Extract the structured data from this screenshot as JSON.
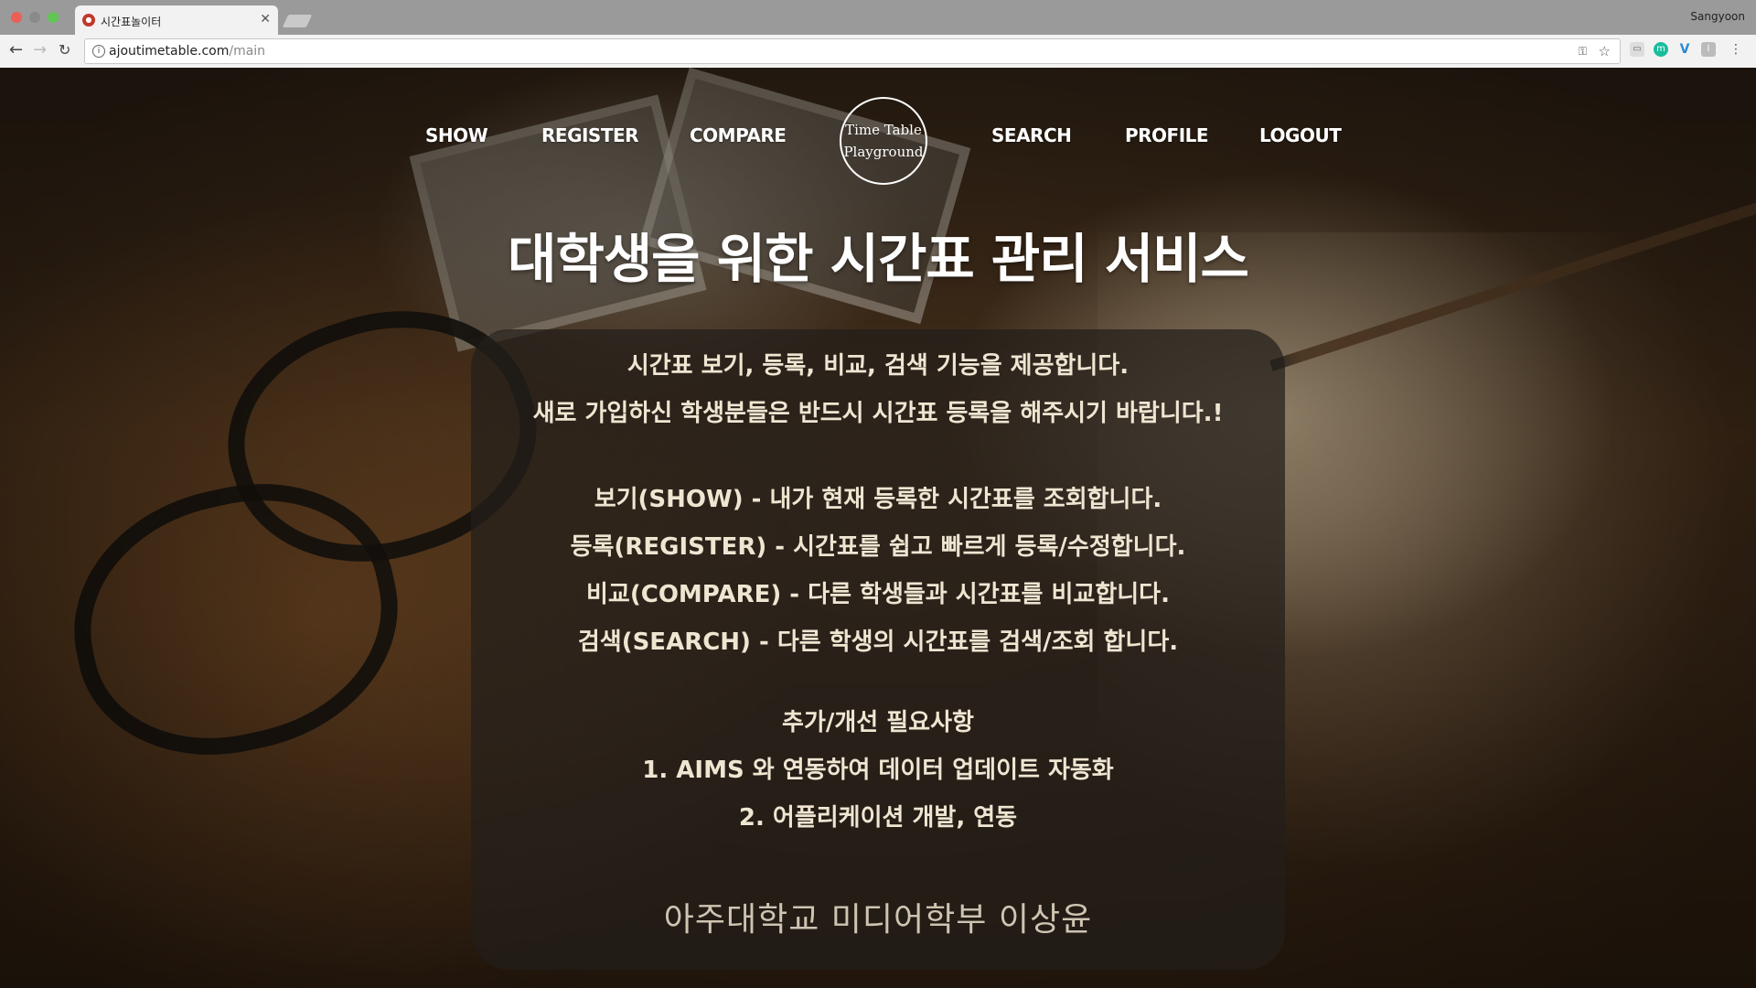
{
  "browser": {
    "tab_title": "시간표놀이터",
    "user_name": "Sangyoon",
    "url_host": "ajoutimetable.com",
    "url_path": "/main"
  },
  "nav": {
    "show": "SHOW",
    "register": "REGISTER",
    "compare": "COMPARE",
    "search": "SEARCH",
    "profile": "PROFILE",
    "logout": "LOGOUT",
    "logo_line1": "Time Table",
    "logo_line2": "Playground"
  },
  "headline": "대학생을 위한 시간표 관리 서비스",
  "panel": {
    "intro": [
      "시간표 보기, 등록, 비교, 검색 기능을 제공합니다.",
      "새로 가입하신 학생분들은 반드시 시간표 등록을 해주시기 바랍니다.!"
    ],
    "features": [
      "보기(SHOW) - 내가 현재 등록한 시간표를 조회합니다.",
      "등록(REGISTER) - 시간표를 쉽고 빠르게 등록/수정합니다.",
      "비교(COMPARE) - 다른 학생들과 시간표를 비교합니다.",
      "검색(SEARCH) - 다른 학생의 시간표를 검색/조회 합니다."
    ],
    "todo": [
      "추가/개선 필요사항",
      "1. AIMS 와 연동하여 데이터 업데이트 자동화",
      "2. 어플리케이션 개발, 연동"
    ],
    "signature": "아주대학교 미디어학부 이상윤"
  },
  "colors": {
    "panel_bg": "#231e1a",
    "panel_text": "#efe6d2",
    "nav_text": "#ffffff"
  },
  "icons": [
    "back-arrow-icon",
    "forward-arrow-icon",
    "reload-icon",
    "info-icon",
    "key-icon",
    "star-icon",
    "menu-dots-icon"
  ]
}
